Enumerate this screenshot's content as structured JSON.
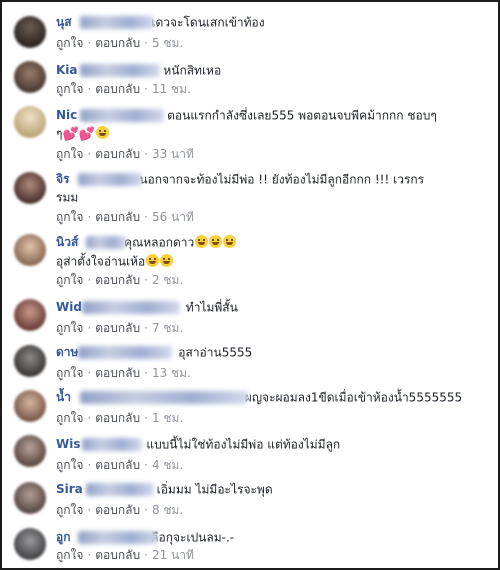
{
  "actions": {
    "like": "ถูกใจ",
    "reply": "ตอบกลับ",
    "sep": "·"
  },
  "comments": [
    {
      "name": "นุส",
      "text": "เดวจะโดนเสกเข้าท้อง",
      "time": "5 ชม."
    },
    {
      "name": "Kia",
      "text": "หนักสิทเหอ",
      "time": "11 ชม."
    },
    {
      "name": "Nic",
      "text": "ตอนแรกกำลังซึ่งเลย555 พอตอนจบพีคม้ากกก ชอบๆ",
      "text2": "ๆ",
      "time": "33 นาที"
    },
    {
      "name": "จิร",
      "text": "นอกจากจะท้องไม่มีพ่อ !! ยังท้องไม่มีลูกอีกกก !!! เวรกร",
      "text2": "รมม",
      "time": "56 นาที"
    },
    {
      "name": "นิวส์",
      "text": "คุณหลอกดาว",
      "text2": "อุส่าตั้งใจอ่านเห้อ",
      "time": "2 ชม."
    },
    {
      "name": "Wid",
      "text": "ทำไมพี่สั้น",
      "time": "7 ชม."
    },
    {
      "name": "ดาษ",
      "text": "อุสาอ่าน5555",
      "time": "13 ชม."
    },
    {
      "name": "น้ำ",
      "text": "ผญจะผอมลง1ขีดเมื่อเข้าห้องน้ำ5555555",
      "time": "1 ชม."
    },
    {
      "name": "Wis",
      "text": "แบบนี้ไม่ใช่ท้องไม่มีพ่อ แต่ท้องไม่มีลูก",
      "time": "4 ชม."
    },
    {
      "name": "Sira",
      "text": "เอิ่มมม ไม่มีอะไรจะพุด",
      "time": "8 ชม."
    },
    {
      "name": "อูก",
      "text": "คือกุจะเปนลม-.-",
      "time": "21 นาที"
    }
  ],
  "colors": {
    "name": "#365899",
    "text": "#1d2129",
    "meta": "#90949c",
    "link": "#4b4f56"
  }
}
